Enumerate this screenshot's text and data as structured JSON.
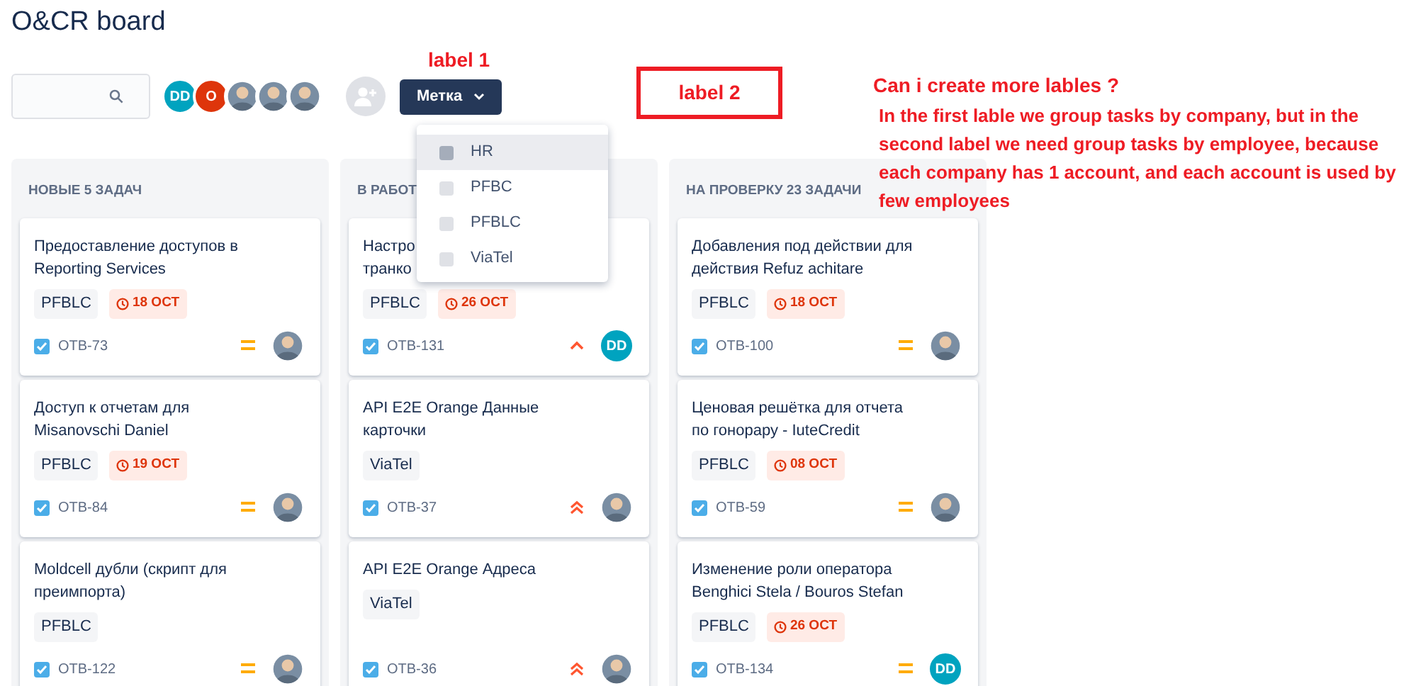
{
  "board": {
    "title": "O&CR board"
  },
  "toolbar": {
    "avatars": [
      {
        "kind": "initials",
        "text": "DD",
        "color": "#00a3bf"
      },
      {
        "kind": "initials",
        "text": "O",
        "color": "#de350b"
      },
      {
        "kind": "photo"
      },
      {
        "kind": "photo"
      },
      {
        "kind": "photo"
      }
    ],
    "label_button": {
      "label": "Метка",
      "expanded": true
    }
  },
  "label_menu": [
    {
      "label": "HR",
      "checked": false,
      "highlighted": true
    },
    {
      "label": "PFBC",
      "checked": false,
      "highlighted": false
    },
    {
      "label": "PFBLC",
      "checked": false,
      "highlighted": false
    },
    {
      "label": "ViaTel",
      "checked": false,
      "highlighted": false
    }
  ],
  "columns": [
    {
      "title": "НОВЫЕ 5 ЗАДАЧ",
      "cards": [
        {
          "title_lines": [
            "Предоставление доступов в",
            "Reporting Services"
          ],
          "tags": [
            "PFBLC"
          ],
          "due": "18 ОСТ",
          "key": "ОТВ-73",
          "priority": {
            "kind": "medium"
          },
          "assignee": {
            "kind": "photo"
          }
        },
        {
          "title_lines": [
            "Доступ к отчетам для",
            "Misanovschi Daniel"
          ],
          "tags": [
            "PFBLC"
          ],
          "due": "19 ОСТ",
          "key": "ОТВ-84",
          "priority": {
            "kind": "medium"
          },
          "assignee": {
            "kind": "photo"
          }
        },
        {
          "title_lines": [
            "Moldcell дубли (скрипт для",
            "преимпорта)"
          ],
          "tags": [
            "PFBLC"
          ],
          "key": "ОТВ-122",
          "priority": {
            "kind": "medium"
          },
          "assignee": {
            "kind": "photo"
          }
        }
      ]
    },
    {
      "title": "В РАБОТ",
      "cards": [
        {
          "title_lines": [
            "Настро",
            "транко"
          ],
          "tags": [
            "PFBLC"
          ],
          "due": "26 ОСТ",
          "key": "ОТВ-131",
          "priority": {
            "kind": "high"
          },
          "assignee": {
            "kind": "initials",
            "text": "DD",
            "color": "#00a3bf"
          }
        },
        {
          "title_lines": [
            "API E2E Orange Данные",
            "карточки"
          ],
          "tags": [
            "ViaTel"
          ],
          "key": "ОТВ-37",
          "priority": {
            "kind": "highest"
          },
          "assignee": {
            "kind": "photo"
          }
        },
        {
          "title_lines": [
            "API E2E Orange Адреса"
          ],
          "tags": [
            "ViaTel"
          ],
          "key": "ОТВ-36",
          "priority": {
            "kind": "highest"
          },
          "assignee": {
            "kind": "photo"
          }
        }
      ]
    },
    {
      "title": "НА ПРОВЕРКУ 23 ЗАДАЧИ",
      "cards": [
        {
          "title_lines": [
            "Добавления под действии для",
            "действия Refuz achitare"
          ],
          "tags": [
            "PFBLC"
          ],
          "due": "18 ОСТ",
          "key": "ОТВ-100",
          "priority": {
            "kind": "medium"
          },
          "assignee": {
            "kind": "photo"
          }
        },
        {
          "title_lines": [
            "Ценовая решётка для отчета",
            "по гонорару - IuteCredit"
          ],
          "tags": [
            "PFBLC"
          ],
          "due": "08 ОСТ",
          "key": "ОТВ-59",
          "priority": {
            "kind": "medium"
          },
          "assignee": {
            "kind": "photo"
          }
        },
        {
          "title_lines": [
            "Изменение роли оператора",
            "Benghici Stela / Bouros Stefan"
          ],
          "tags": [
            "PFBLC"
          ],
          "due": "26 ОСТ",
          "key": "ОТВ-134",
          "priority": {
            "kind": "medium"
          },
          "assignee": {
            "kind": "initials",
            "text": "DD",
            "color": "#00a3bf"
          }
        }
      ]
    }
  ],
  "annotations": {
    "label_1": "label 1",
    "label_2": "label 2",
    "question": "Can i create more lables ?",
    "explanation": "In the first lable we group tasks by company, but in the second label we need group tasks by employee, because each company has 1 account, and each account is used by few employees"
  }
}
